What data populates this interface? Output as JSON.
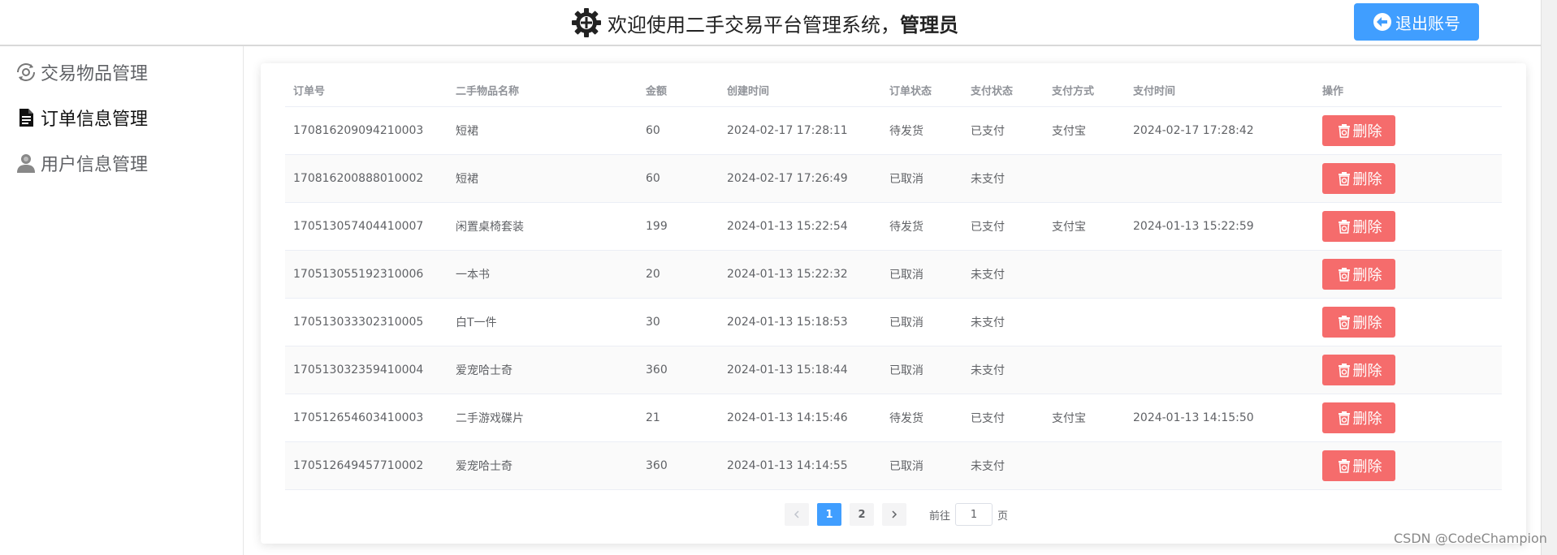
{
  "header": {
    "title_prefix": "欢迎使用二手交易平台管理系统，",
    "title_role": "管理员",
    "logout_label": "退出账号"
  },
  "sidebar": {
    "items": [
      {
        "label": "交易物品管理",
        "icon": "eye-refresh-icon",
        "active": false
      },
      {
        "label": "订单信息管理",
        "icon": "document-icon",
        "active": true
      },
      {
        "label": "用户信息管理",
        "icon": "user-icon",
        "active": false
      }
    ]
  },
  "table": {
    "columns": [
      "订单号",
      "二手物品名称",
      "金额",
      "创建时间",
      "订单状态",
      "支付状态",
      "支付方式",
      "支付时间",
      "操作"
    ],
    "rows": [
      {
        "order_no": "170816209094210003",
        "item": "短裙",
        "amount": "60",
        "created": "2024-02-17 17:28:11",
        "order_status": "待发货",
        "pay_status": "已支付",
        "pay_method": "支付宝",
        "pay_time": "2024-02-17 17:28:42",
        "action": "删除"
      },
      {
        "order_no": "170816200888010002",
        "item": "短裙",
        "amount": "60",
        "created": "2024-02-17 17:26:49",
        "order_status": "已取消",
        "pay_status": "未支付",
        "pay_method": "",
        "pay_time": "",
        "action": "删除"
      },
      {
        "order_no": "170513057404410007",
        "item": "闲置桌椅套装",
        "amount": "199",
        "created": "2024-01-13 15:22:54",
        "order_status": "待发货",
        "pay_status": "已支付",
        "pay_method": "支付宝",
        "pay_time": "2024-01-13 15:22:59",
        "action": "删除"
      },
      {
        "order_no": "170513055192310006",
        "item": "一本书",
        "amount": "20",
        "created": "2024-01-13 15:22:32",
        "order_status": "已取消",
        "pay_status": "未支付",
        "pay_method": "",
        "pay_time": "",
        "action": "删除"
      },
      {
        "order_no": "170513033302310005",
        "item": "白T一件",
        "amount": "30",
        "created": "2024-01-13 15:18:53",
        "order_status": "已取消",
        "pay_status": "未支付",
        "pay_method": "",
        "pay_time": "",
        "action": "删除"
      },
      {
        "order_no": "170513032359410004",
        "item": "爱宠哈士奇",
        "amount": "360",
        "created": "2024-01-13 15:18:44",
        "order_status": "已取消",
        "pay_status": "未支付",
        "pay_method": "",
        "pay_time": "",
        "action": "删除"
      },
      {
        "order_no": "170512654603410003",
        "item": "二手游戏碟片",
        "amount": "21",
        "created": "2024-01-13 14:15:46",
        "order_status": "待发货",
        "pay_status": "已支付",
        "pay_method": "支付宝",
        "pay_time": "2024-01-13 14:15:50",
        "action": "删除"
      },
      {
        "order_no": "170512649457710002",
        "item": "爱宠哈士奇",
        "amount": "360",
        "created": "2024-01-13 14:14:55",
        "order_status": "已取消",
        "pay_status": "未支付",
        "pay_method": "",
        "pay_time": "",
        "action": "删除"
      }
    ]
  },
  "pagination": {
    "pages": [
      "1",
      "2"
    ],
    "current": "1",
    "goto_prefix": "前往",
    "goto_value": "1",
    "goto_suffix": "页"
  },
  "watermark": "CSDN @CodeChampion",
  "colors": {
    "primary": "#409eff",
    "danger": "#f56c6c"
  }
}
